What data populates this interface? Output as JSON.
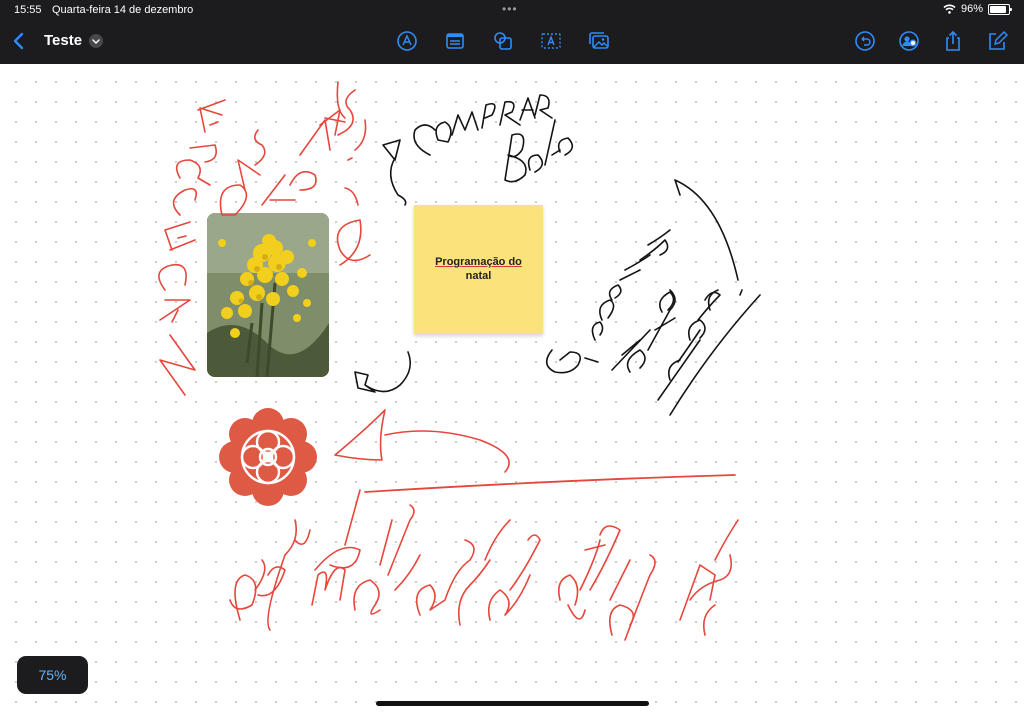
{
  "status_bar": {
    "time": "15:55",
    "date": "Quarta-feira 14 de dezembro",
    "multitask_dots": "•••",
    "battery": "96%",
    "battery_level": 0.96
  },
  "nav": {
    "title": "Teste",
    "tools": [
      "pen-tool-icon",
      "text-box-icon",
      "shapes-icon",
      "text-frame-icon",
      "photo-gallery-icon"
    ],
    "actions": [
      "undo-icon",
      "collaborate-icon",
      "share-icon",
      "new-note-icon"
    ],
    "accent": "#2f8cf8"
  },
  "board": {
    "sticky_note": "Programação do natal",
    "zoom": "75%",
    "ink_colors": {
      "red": "#e6463b",
      "black": "#141414"
    },
    "flower_color": "#de5a44",
    "sticky_color": "#fbe27a"
  }
}
